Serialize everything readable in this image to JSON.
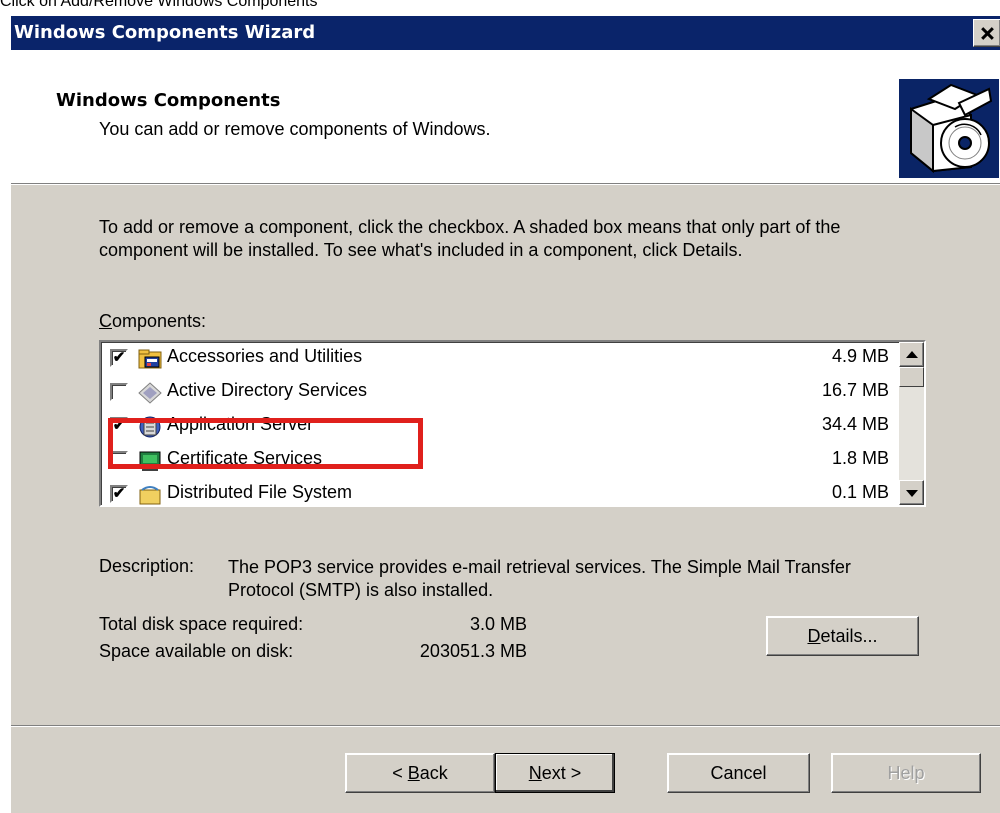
{
  "caption": "Click on Add/Remove Windows Components",
  "window": {
    "title": "Windows Components Wizard"
  },
  "header": {
    "title": "Windows Components",
    "subtitle": "You can add or remove components of Windows."
  },
  "content": {
    "instructions": "To add or remove a component, click the checkbox. A shaded box means that only part of the component will be installed. To see what's included in a component, click Details.",
    "components_label_accel": "C",
    "components_label_rest": "omponents:",
    "components": [
      {
        "name": "Accessories and Utilities",
        "size": "4.9 MB",
        "checked": true,
        "icon": "accessories-icon"
      },
      {
        "name": "Active Directory Services",
        "size": "16.7 MB",
        "checked": false,
        "icon": "active-directory-icon"
      },
      {
        "name": "Application Server",
        "size": "34.4 MB",
        "checked": true,
        "icon": "application-server-icon"
      },
      {
        "name": "Certificate Services",
        "size": "1.8 MB",
        "checked": false,
        "icon": "certificate-services-icon"
      },
      {
        "name": "Distributed File System",
        "size": "0.1 MB",
        "checked": true,
        "icon": "distributed-file-system-icon"
      }
    ],
    "description_label": "Description:",
    "description_text": "The POP3 service provides e-mail retrieval services. The Simple Mail Transfer Protocol (SMTP) is also installed.",
    "total_space_label": "Total disk space required:",
    "total_space_value": "3.0 MB",
    "available_space_label": "Space available on disk:",
    "available_space_value": "203051.3 MB",
    "details_accel": "D",
    "details_rest": "etails..."
  },
  "buttons": {
    "back_prefix": "< ",
    "back_accel": "B",
    "back_rest": "ack",
    "next_accel": "N",
    "next_rest": "ext >",
    "cancel": "Cancel",
    "help": "Help"
  },
  "colors": {
    "titlebar": "#0a246a",
    "face": "#d4d0c8",
    "highlight_box": "#e0201c"
  }
}
